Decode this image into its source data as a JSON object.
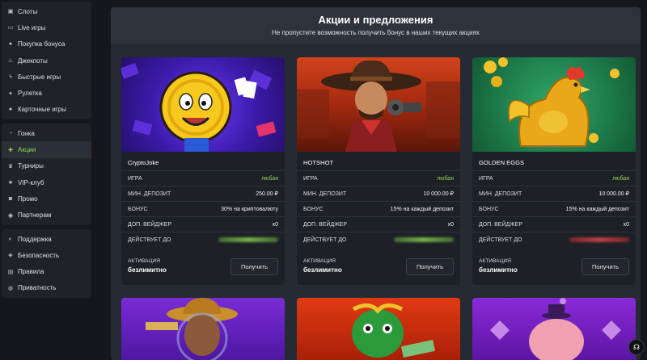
{
  "sidebar": {
    "group1": [
      {
        "icon": "slot-icon",
        "label": "Слоты"
      },
      {
        "icon": "live-icon",
        "label": "Live игры"
      },
      {
        "icon": "coin-icon",
        "label": "Покупка бонуса"
      },
      {
        "icon": "flame-icon",
        "label": "Джекпоты"
      },
      {
        "icon": "bolt-icon",
        "label": "Быстрые игры"
      },
      {
        "icon": "roulette-icon",
        "label": "Рулетка"
      },
      {
        "icon": "cards-icon",
        "label": "Карточные игры"
      }
    ],
    "group2": [
      {
        "icon": "race-icon",
        "label": "Гонка"
      },
      {
        "icon": "gift-icon",
        "label": "Акции"
      },
      {
        "icon": "trophy-icon",
        "label": "Турниры"
      },
      {
        "icon": "star-icon",
        "label": "VIP-клуб"
      },
      {
        "icon": "promo-icon",
        "label": "Промо"
      },
      {
        "icon": "partner-icon",
        "label": "Партнерам"
      }
    ],
    "group3": [
      {
        "icon": "support-icon",
        "label": "Поддержка"
      },
      {
        "icon": "shield-icon",
        "label": "Безопасность"
      },
      {
        "icon": "rules-icon",
        "label": "Правила"
      },
      {
        "icon": "privacy-icon",
        "label": "Приватность"
      }
    ]
  },
  "header": {
    "title": "Акции и предложения",
    "subtitle": "Не пропустите возможность получить бонус в наших текущих акциях"
  },
  "row_labels": {
    "game": "ИГРА",
    "min_deposit": "МИН. ДЕПОЗИТ",
    "bonus": "БОНУС",
    "wager": "ДОП. ВЕЙДЖЕР",
    "valid": "ДЕЙСТВУЕТ ДО"
  },
  "activation": {
    "label": "АКТИВАЦИЯ",
    "value": "безлимитно"
  },
  "get_button": "Получить",
  "cards": [
    {
      "name": "CryptoJoke",
      "game": "любая",
      "min_deposit": "250.00 ₽",
      "bonus": "30% на криптовалюту",
      "wager": "x0"
    },
    {
      "name": "HOTSHOT",
      "game": "любая",
      "min_deposit": "10 000.00 ₽",
      "bonus": "15% на каждый депозит",
      "wager": "x0"
    },
    {
      "name": "GOLDEN EGGS",
      "game": "любая",
      "min_deposit": "10 000.00 ₽",
      "bonus": "15% на каждый депозит",
      "wager": "x0"
    }
  ],
  "colors": {
    "accent": "#8ed44e",
    "bg": "#15171c",
    "panel": "#262a33"
  }
}
